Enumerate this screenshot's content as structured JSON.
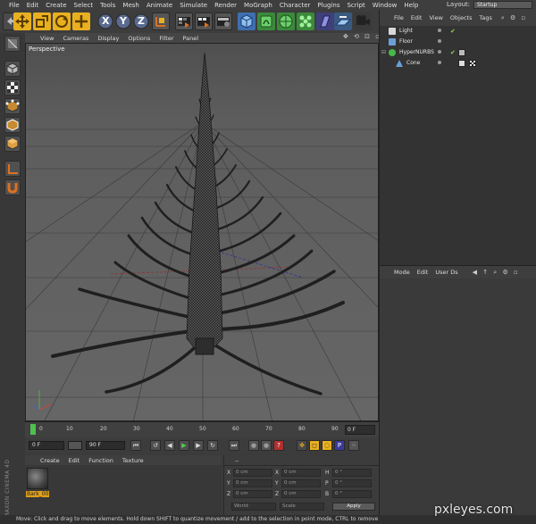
{
  "menubar": {
    "items": [
      "File",
      "Edit",
      "Create",
      "Select",
      "Tools",
      "Mesh",
      "Animate",
      "Simulate",
      "Render",
      "MoGraph",
      "Character",
      "Plugins",
      "Script",
      "Window",
      "Help"
    ],
    "layout_label": "Layout:",
    "layout_value": "Startup"
  },
  "toolbar": {
    "axis_x": "X",
    "axis_y": "Y",
    "axis_z": "Z"
  },
  "viewport": {
    "menu": [
      "View",
      "Cameras",
      "Display",
      "Options",
      "Filter",
      "Panel"
    ],
    "label": "Perspective",
    "nav_icons": "✥ ⟲ ⊡ ▫"
  },
  "timeline": {
    "ticks": [
      "0",
      "10",
      "20",
      "30",
      "40",
      "50",
      "60",
      "70",
      "80",
      "90"
    ],
    "end_field": "0 F"
  },
  "transport": {
    "start_field": "0 F",
    "end_field": "90 F"
  },
  "material_manager": {
    "menu": [
      "Create",
      "Edit",
      "Function",
      "Texture"
    ],
    "material_name": "Bark_00"
  },
  "coordinates": {
    "header": "--",
    "rows": [
      {
        "k1": "X",
        "v1": "0 cm",
        "k2": "X",
        "v2": "0 cm",
        "k3": "H",
        "v3": "0 °"
      },
      {
        "k1": "Y",
        "v1": "0 cm",
        "k2": "Y",
        "v2": "0 cm",
        "k3": "P",
        "v3": "0 °"
      },
      {
        "k1": "Z",
        "v1": "0 cm",
        "k2": "Z",
        "v2": "0 cm",
        "k3": "B",
        "v3": "0 °"
      }
    ],
    "mode_world": "World",
    "mode_scale": "Scale",
    "apply_label": "Apply"
  },
  "object_manager": {
    "menu": [
      "File",
      "Edit",
      "View",
      "Objects",
      "Tags"
    ],
    "objects": [
      {
        "name": "Light",
        "icon_color": "#d8d8d8"
      },
      {
        "name": "Floor",
        "icon_color": "#6aa0d8"
      },
      {
        "name": "HyperNURBS",
        "icon_color": "#49b849"
      },
      {
        "name": "Cone",
        "icon_color": "#6aa0d8"
      }
    ]
  },
  "attribute_manager": {
    "menu": [
      "Mode",
      "Edit",
      "User Ds"
    ]
  },
  "branding": {
    "maxon": "MAXON CINEMA 4D"
  },
  "statusbar": {
    "text": "Move: Click and drag to move elements. Hold down SHIFT to quantize movement / add to the selection in point mode, CTRL to remove"
  },
  "watermark": "pxleyes.com"
}
